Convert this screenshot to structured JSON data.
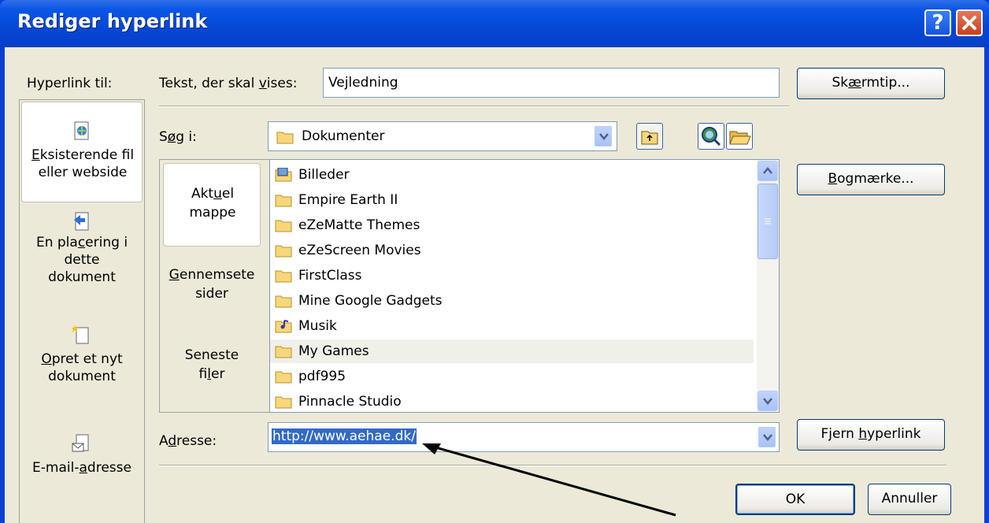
{
  "window": {
    "title": "Rediger hyperlink",
    "help_label": "?",
    "close_label": "✕"
  },
  "sidebar": {
    "header": "Hyperlink til:",
    "items": [
      {
        "icon": "web-page-icon",
        "label_line1_u": "E",
        "label_line1": "ksisterende fil",
        "label_line2": "eller webside",
        "selected": true
      },
      {
        "icon": "document-place-icon",
        "label_line1": "En pla",
        "label_line1_u": "c",
        "label_line1_rest": "ering i",
        "label_line2": "dette",
        "label_line3": "dokument",
        "selected": false
      },
      {
        "icon": "new-document-icon",
        "label_line1_u": "O",
        "label_line1": "pret et nyt",
        "label_line2": "dokument",
        "selected": false
      },
      {
        "icon": "email-icon",
        "label_line1": "E-mail-",
        "label_line1_u": "a",
        "label_line1_rest": "dresse",
        "selected": false
      }
    ]
  },
  "text_field": {
    "label_pre": "Tekst, der skal ",
    "label_u": "v",
    "label_post": "ises:",
    "value": "Vejledning"
  },
  "screen_tip_button": {
    "pre": "Sk",
    "u": "æ",
    "post": "rmtip..."
  },
  "look_in": {
    "label_pre": "S",
    "label_u": "ø",
    "label_post": "g i:",
    "value": "Dokumenter"
  },
  "view_tabs": [
    {
      "line1_pre": "Akt",
      "line1_u": "u",
      "line1_post": "el",
      "line2": "mappe",
      "selected": true
    },
    {
      "line1_pre": "",
      "line1_u": "G",
      "line1_post": "ennemsete",
      "line2": "sider",
      "selected": false
    },
    {
      "line1_pre": "Seneste",
      "line1_u": "",
      "line1_post": "",
      "line2_pre": "fi",
      "line2_u": "l",
      "line2_post": "er",
      "selected": false
    }
  ],
  "file_list": [
    {
      "name": "Billeder",
      "icon": "pictures-folder-icon",
      "selected": false
    },
    {
      "name": "Empire Earth II",
      "icon": "folder-icon",
      "selected": false
    },
    {
      "name": "eZeMatte Themes",
      "icon": "folder-icon",
      "selected": false
    },
    {
      "name": "eZeScreen Movies",
      "icon": "folder-icon",
      "selected": false
    },
    {
      "name": "FirstClass",
      "icon": "folder-icon",
      "selected": false
    },
    {
      "name": "Mine Google Gadgets",
      "icon": "folder-icon",
      "selected": false
    },
    {
      "name": "Musik",
      "icon": "music-folder-icon",
      "selected": false
    },
    {
      "name": "My Games",
      "icon": "folder-icon",
      "selected": true
    },
    {
      "name": "pdf995",
      "icon": "folder-icon",
      "selected": false
    },
    {
      "name": "Pinnacle Studio",
      "icon": "folder-icon",
      "selected": false
    }
  ],
  "bookmark_button": {
    "pre": "",
    "u": "B",
    "post": "ogmærke..."
  },
  "address": {
    "label_pre": "A",
    "label_u": "d",
    "label_post": "resse:",
    "value": "http://www.aehae.dk/"
  },
  "remove_link_button": {
    "pre": "Fjern ",
    "u": "h",
    "post": "yperlink"
  },
  "ok_button": "OK",
  "cancel_button": "Annuller",
  "colors": {
    "title_bar": "#0a56e6",
    "dialog_bg": "#ece9d8",
    "selection": "#316ac5"
  }
}
